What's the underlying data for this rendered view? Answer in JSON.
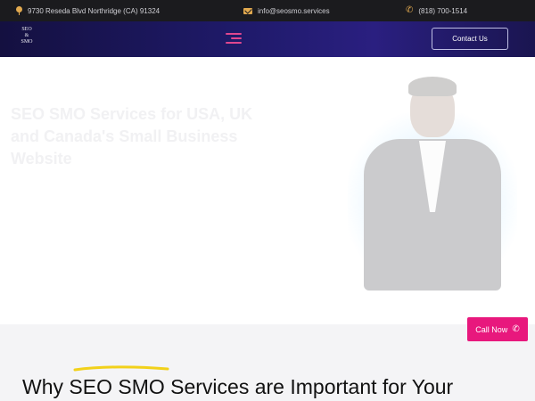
{
  "topbar": {
    "address": "9730 Reseda Blvd Northridge (CA) 91324",
    "email": "info@seosmo.services",
    "phone": "(818) 700-1514"
  },
  "navbar": {
    "logo_lines": [
      "SEO",
      "&",
      "SMO"
    ],
    "contact_label": "Contact Us"
  },
  "hero": {
    "title": "SEO SMO Services for USA, UK and Canada's Small Business Website"
  },
  "floating": {
    "call_label": "Call Now"
  },
  "section": {
    "heading": "Why SEO SMO Services are Important for Your"
  },
  "colors": {
    "topbar_bg": "#1b1b1e",
    "nav_bg": "#1f1a6a",
    "accent_pink": "#e8187d",
    "icon_gold": "#e1a94f",
    "underline_yellow": "#f2d11a"
  },
  "icons": [
    "map-pin-icon",
    "envelope-icon",
    "phone-icon",
    "hamburger-menu-icon",
    "phone-call-icon"
  ]
}
